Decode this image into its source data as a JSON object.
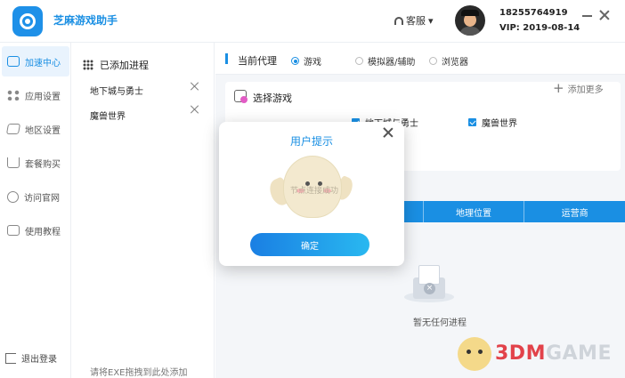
{
  "app": {
    "title": "芝麻游戏助手"
  },
  "header": {
    "service_label": "客服",
    "phone": "18255764919",
    "vip": "VIP: 2019-08-14"
  },
  "nav": {
    "items": [
      {
        "label": "加速中心",
        "icon": "gamepad-icon",
        "active": true
      },
      {
        "label": "应用设置",
        "icon": "grid-icon",
        "active": false
      },
      {
        "label": "地区设置",
        "icon": "map-icon",
        "active": false
      },
      {
        "label": "套餐购买",
        "icon": "cart-icon",
        "active": false
      },
      {
        "label": "访问官网",
        "icon": "globe-icon",
        "active": false
      },
      {
        "label": "使用教程",
        "icon": "book-icon",
        "active": false
      }
    ],
    "logout_label": "退出登录"
  },
  "processes": {
    "header": "已添加进程",
    "items": [
      "地下城与勇士",
      "魔兽世界"
    ],
    "drag_hint": "请将EXE拖拽到此处添加"
  },
  "proxy": {
    "title": "当前代理",
    "options": [
      {
        "label": "游戏",
        "selected": true
      },
      {
        "label": "模拟器/辅助",
        "selected": false
      },
      {
        "label": "浏览器",
        "selected": false
      }
    ]
  },
  "game_select": {
    "title": "选择游戏",
    "add_more": "添加更多",
    "games": [
      {
        "label": "地下城与勇士",
        "checked": true
      },
      {
        "label": "魔兽世界",
        "checked": true
      }
    ]
  },
  "table": {
    "headers": [
      "P",
      "地理位置",
      "运营商"
    ]
  },
  "empty": {
    "text": "暂无任何进程"
  },
  "modal": {
    "title": "用户提示",
    "caption": "节点连接成功",
    "confirm_label": "确定"
  },
  "watermark": {
    "text_accent": "3DM",
    "text_rest": "GAME"
  },
  "colors": {
    "accent": "#1a8fe3",
    "nav_active_bg": "#e9f3fd"
  }
}
